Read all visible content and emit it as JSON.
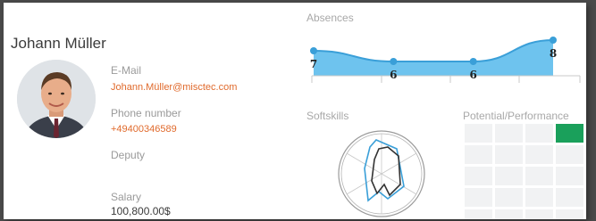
{
  "profile": {
    "name": "Johann Müller",
    "email_label": "E-Mail",
    "email_value": "Johann.Müller@misctec.com",
    "phone_label": "Phone number",
    "phone_value": "+49400346589",
    "deputy_label": "Deputy",
    "salary_label": "Salary",
    "salary_value": "100,800.00$"
  },
  "absences": {
    "title": "Absences",
    "values": [
      7,
      6,
      6,
      8
    ],
    "colors": {
      "line": "#3a9fd8",
      "fill": "#6ec3ee"
    }
  },
  "softskills": {
    "title": "Softskills",
    "colors": {
      "ring": "#9a9a9a",
      "profile": "#3a9fd8",
      "target": "#333333"
    }
  },
  "performance": {
    "title": "Potential/Performance",
    "active_cell": {
      "row": 0,
      "col": 3
    },
    "colors": {
      "active": "#1aa05b",
      "cell": "#f1f2f3"
    }
  }
}
